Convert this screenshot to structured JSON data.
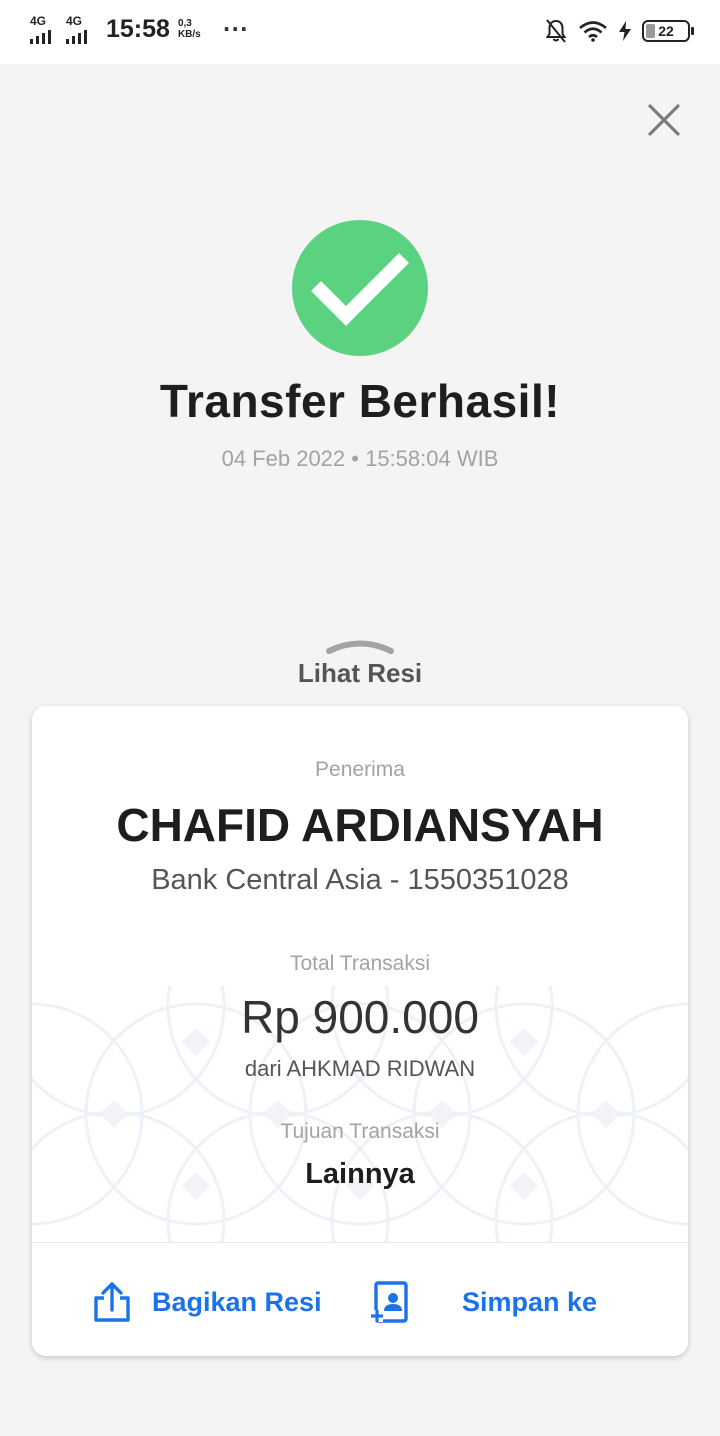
{
  "status_bar": {
    "signal_1": "4G",
    "signal_2": "4G",
    "time": "15:58",
    "speed_value": "0,3",
    "speed_unit": "KB/s",
    "more": "···",
    "battery": "22"
  },
  "success": {
    "title": "Transfer Berhasil!",
    "datetime": "04 Feb 2022 • 15:58:04 WIB"
  },
  "receipt_toggle": {
    "label": "Lihat Resi"
  },
  "receipt": {
    "recipient_label": "Penerima",
    "recipient_name": "CHAFID ARDIANSYAH",
    "recipient_bank": "Bank Central Asia - 1550351028",
    "total_label": "Total Transaksi",
    "amount": "Rp 900.000",
    "sender": "dari AHKMAD RIDWAN",
    "purpose_label": "Tujuan Transaksi",
    "purpose": "Lainnya"
  },
  "actions": {
    "share_label": "Bagikan Resi",
    "save_label": "Simpan ke"
  },
  "colors": {
    "accent": "#1a73e8",
    "success": "#5bd27f"
  }
}
